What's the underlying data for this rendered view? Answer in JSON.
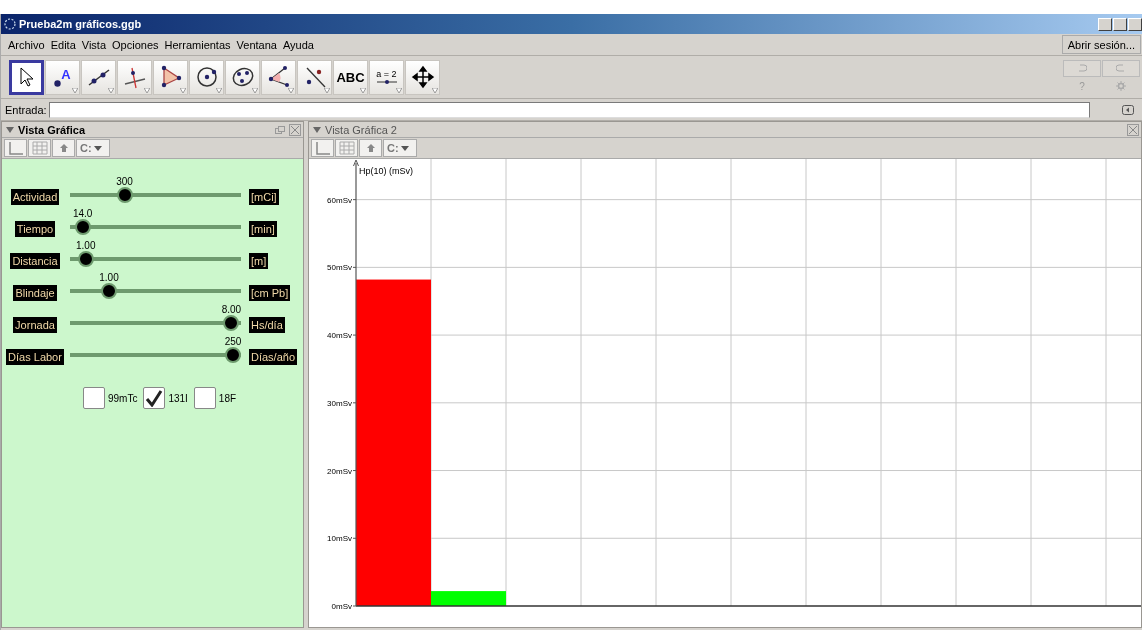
{
  "window": {
    "title": "Prueba2m gráficos.ggb"
  },
  "menu": [
    "Archivo",
    "Edita",
    "Vista",
    "Opciones",
    "Herramientas",
    "Ventana",
    "Ayuda"
  ],
  "login_button": "Abrir sesión...",
  "tools": [
    {
      "kind": "pointer",
      "selected": true
    },
    {
      "kind": "point",
      "selected": false,
      "label": "A"
    },
    {
      "kind": "line",
      "selected": false
    },
    {
      "kind": "perpendicular",
      "selected": false
    },
    {
      "kind": "polygon",
      "selected": false
    },
    {
      "kind": "circle",
      "selected": false
    },
    {
      "kind": "ellipse",
      "selected": false
    },
    {
      "kind": "angle",
      "selected": false
    },
    {
      "kind": "reflect",
      "selected": false
    },
    {
      "kind": "text",
      "selected": false,
      "label": "ABC"
    },
    {
      "kind": "slider",
      "selected": false,
      "label": "a = 2"
    },
    {
      "kind": "move",
      "selected": false
    }
  ],
  "help_label": "?",
  "input_bar": {
    "label": "Entrada:"
  },
  "left_view": {
    "title": "Vista Gráfica",
    "toolbar_label": "C:",
    "sliders": [
      {
        "label": "Actividad",
        "value": "300",
        "unit": "[mCi]",
        "level": 0.3
      },
      {
        "label": "Tiempo",
        "value": "14.0",
        "unit": "[min]",
        "level": 0.03
      },
      {
        "label": "Distancia",
        "value": "1.00",
        "unit": "[m]",
        "level": 0.05
      },
      {
        "label": "Blindaje",
        "value": "1.00",
        "unit": "[cm Pb]",
        "level": 0.2
      },
      {
        "label": "Jornada",
        "value": "8.00",
        "unit": "Hs/día",
        "level": 0.99
      },
      {
        "label": "Días Labor",
        "value": "250",
        "unit": "Días/año",
        "level": 1
      }
    ],
    "checkboxes": [
      {
        "label": "99mTc",
        "checked": false
      },
      {
        "label": "131I",
        "checked": true
      },
      {
        "label": "18F",
        "checked": false
      }
    ]
  },
  "right_view": {
    "title": "Vista Gráfica 2",
    "toolbar_label": "C:",
    "chart_data": {
      "type": "bar",
      "grid": true,
      "ylabel": "Hp(10) (mSv)",
      "stacked": true,
      "ylim": [
        0,
        66
      ],
      "yticks": [
        {
          "value": 0,
          "label": "0mSv"
        },
        {
          "value": 10,
          "label": "10mSv"
        },
        {
          "value": 20,
          "label": "20mSv"
        },
        {
          "value": 30,
          "label": "30mSv"
        },
        {
          "value": 40,
          "label": "40mSv"
        },
        {
          "value": 50,
          "label": "50mSv"
        },
        {
          "value": 60,
          "label": "60mSv"
        }
      ],
      "series": [
        {
          "color": "#ff0000",
          "values": [
            48.2,
            null
          ]
        },
        {
          "color": "#00ff00",
          "values": [
            null,
            2.2
          ]
        }
      ]
    }
  }
}
